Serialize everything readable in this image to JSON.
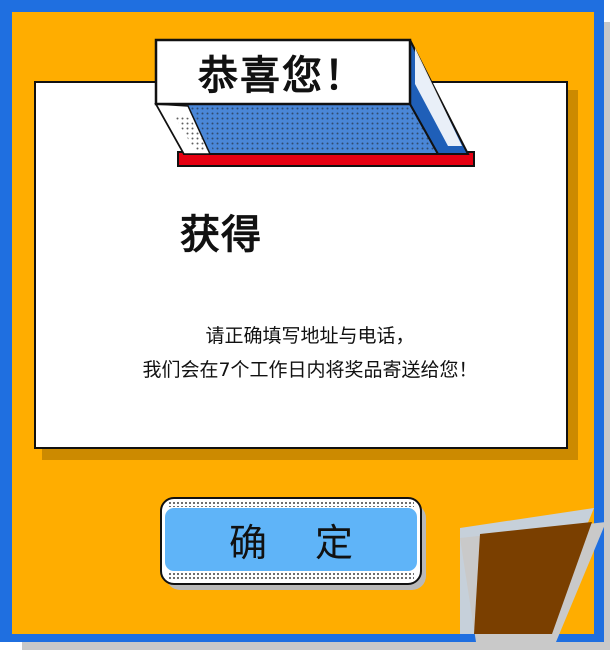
{
  "dialog": {
    "title": "恭喜您！",
    "prize_label": "获得",
    "message_line1": "请正确填写地址与电话，",
    "message_line2": "我们会在7个工作日内将奖品寄送给您！",
    "confirm_label": "确 定"
  },
  "colors": {
    "frame_blue": "#1f6fe0",
    "card_orange": "#ffad00",
    "fold_brown": "#7a3f00",
    "banner_blue": "#4a87d8",
    "banner_red": "#e60012",
    "button_blue": "#5fb4f8",
    "text_dark": "#111111"
  }
}
